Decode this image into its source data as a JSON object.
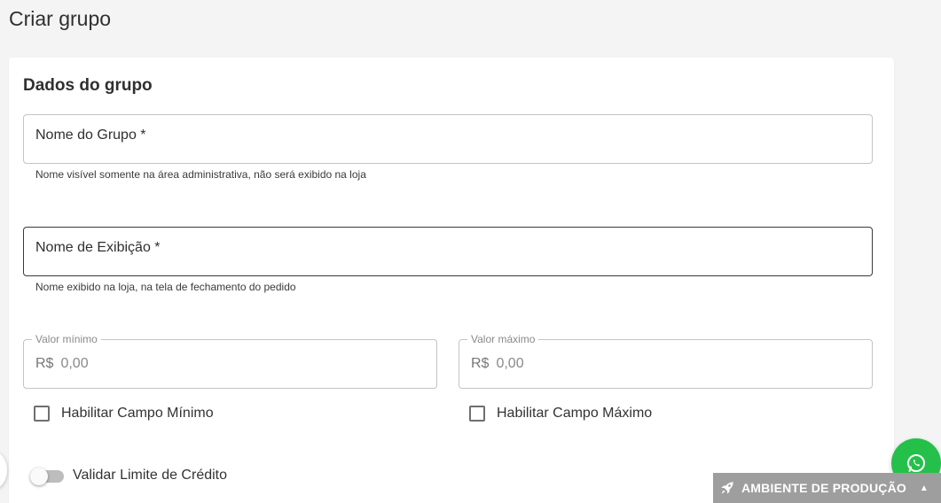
{
  "page": {
    "title": "Criar grupo"
  },
  "card": {
    "section_title": "Dados do grupo",
    "group_name": {
      "label": "Nome do Grupo *",
      "helper": "Nome visível somente na área administrativa, não será exibido na loja"
    },
    "display_name": {
      "label": "Nome de Exibição *",
      "helper": "Nome exibido na loja, na tela de fechamento do pedido"
    },
    "min_value": {
      "label": "Valor mínimo",
      "currency": "R$",
      "placeholder": "0,00"
    },
    "max_value": {
      "label": "Valor máximo",
      "currency": "R$",
      "placeholder": "0,00"
    },
    "enable_min": {
      "label": "Habilitar Campo Mínimo",
      "checked": false
    },
    "enable_max": {
      "label": "Habilitar Campo Máximo",
      "checked": false
    },
    "credit_limit": {
      "label": "Validar Limite de Crédito",
      "on": false
    }
  },
  "env_bar": {
    "label": "AMBIENTE DE PRODUÇÃO",
    "icon": "rocket-icon",
    "caret_icon": "caret-up-icon"
  },
  "whatsapp": {
    "icon": "whatsapp-icon",
    "color": "#25c04a"
  }
}
